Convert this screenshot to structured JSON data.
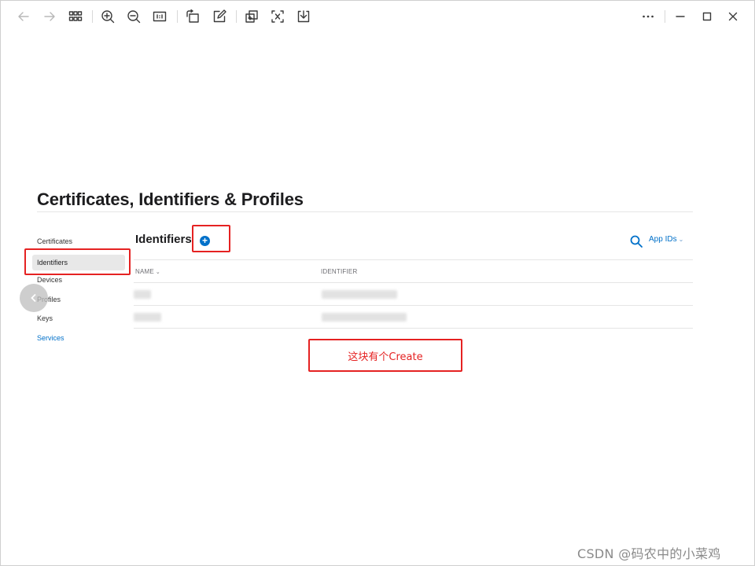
{
  "page": {
    "title": "Certificates, Identifiers & Profiles"
  },
  "sidebar": {
    "items": [
      {
        "label": "Certificates"
      },
      {
        "label": "Identifiers"
      },
      {
        "label": "Devices"
      },
      {
        "label": "Profiles"
      },
      {
        "label": "Keys"
      },
      {
        "label": "Services"
      }
    ],
    "active": "Identifiers"
  },
  "main": {
    "section_title": "Identifiers",
    "add_button": "+",
    "filter_label": "App IDs",
    "filter_chevron": "⌄",
    "columns": [
      {
        "label": "NAME",
        "chevron": "⌄"
      },
      {
        "label": "IDENTIFIER"
      }
    ]
  },
  "annotation": {
    "note": "这块有个Create"
  },
  "watermark": "CSDN @码农中的小菜鸡",
  "colors": {
    "accent": "#0070c9",
    "annotation": "#e52222"
  }
}
